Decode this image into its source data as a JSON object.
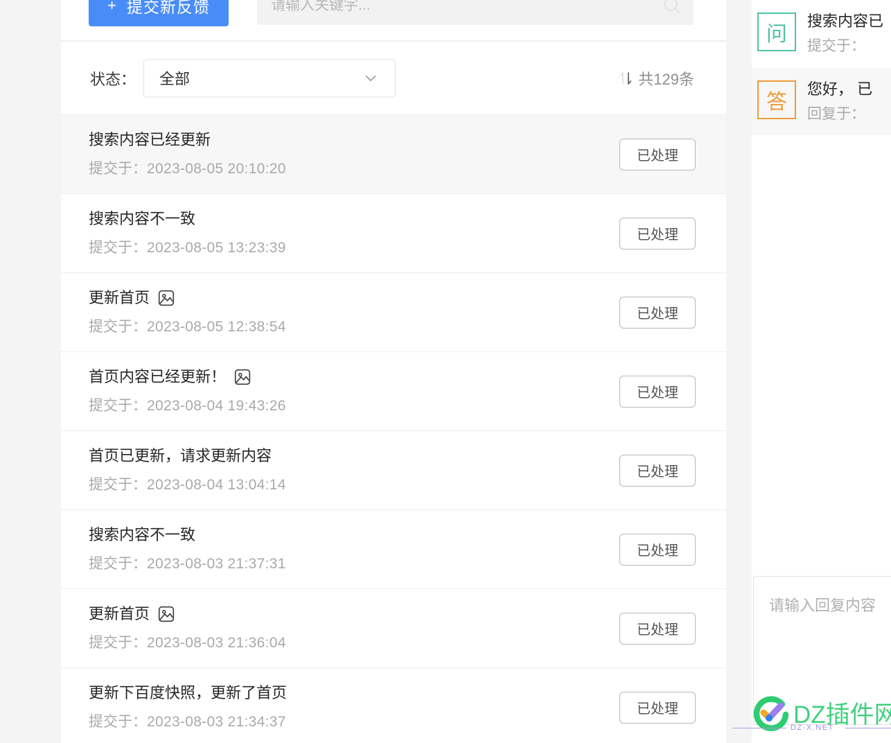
{
  "toolbar": {
    "new_feedback_label": "提交新反馈",
    "plus_icon": "plus-icon",
    "search_placeholder": "请输入关键字...",
    "search_value": "",
    "search_icon": "search-icon"
  },
  "filter": {
    "status_label": "状态：",
    "status_value": "全部",
    "status_options": [
      "全部"
    ],
    "chevron_icon": "chevron-down-icon",
    "sort_icon": "sort-updown-icon",
    "count_text": "共129条",
    "count_number": 129
  },
  "colors": {
    "primary_button": "#4a8cf7",
    "question_badge": "#4ec2a5",
    "answer_badge": "#ee9c3a",
    "page_background": "#f4f4f4",
    "panel_background": "#ffffff",
    "row_active": "#f7f7f7",
    "watermark_green": "#41d17f",
    "watermark_purple": "#9a8fe0"
  },
  "list": {
    "time_prefix": "提交于：",
    "rows": [
      {
        "title": "搜索内容已经更新",
        "time": "2023-08-05 20:10:20",
        "status": "已处理",
        "has_image": false,
        "active": true
      },
      {
        "title": "搜索内容不一致",
        "time": "2023-08-05 13:23:39",
        "status": "已处理",
        "has_image": false,
        "active": false
      },
      {
        "title": "更新首页",
        "time": "2023-08-05 12:38:54",
        "status": "已处理",
        "has_image": true,
        "active": false
      },
      {
        "title": "首页内容已经更新！",
        "time": "2023-08-04 19:43:26",
        "status": "已处理",
        "has_image": true,
        "active": false
      },
      {
        "title": "首页已更新，请求更新内容",
        "time": "2023-08-04 13:04:14",
        "status": "已处理",
        "has_image": false,
        "active": false
      },
      {
        "title": "搜索内容不一致",
        "time": "2023-08-03 21:37:31",
        "status": "已处理",
        "has_image": false,
        "active": false
      },
      {
        "title": "更新首页",
        "time": "2023-08-03 21:36:04",
        "status": "已处理",
        "has_image": true,
        "active": false
      },
      {
        "title": "更新下百度快照，更新了首页",
        "time": "2023-08-03 21:34:37",
        "status": "已处理",
        "has_image": false,
        "active": false
      }
    ]
  },
  "detail": {
    "question": {
      "badge": "问",
      "title": "搜索内容已",
      "sub": "提交于："
    },
    "answer": {
      "badge": "答",
      "title": "您好， 已",
      "sub": "回复于："
    },
    "reply_placeholder": "请输入回复内容"
  },
  "watermark": {
    "brand": "DZ插件网",
    "domain": "DZ-X.NET"
  }
}
